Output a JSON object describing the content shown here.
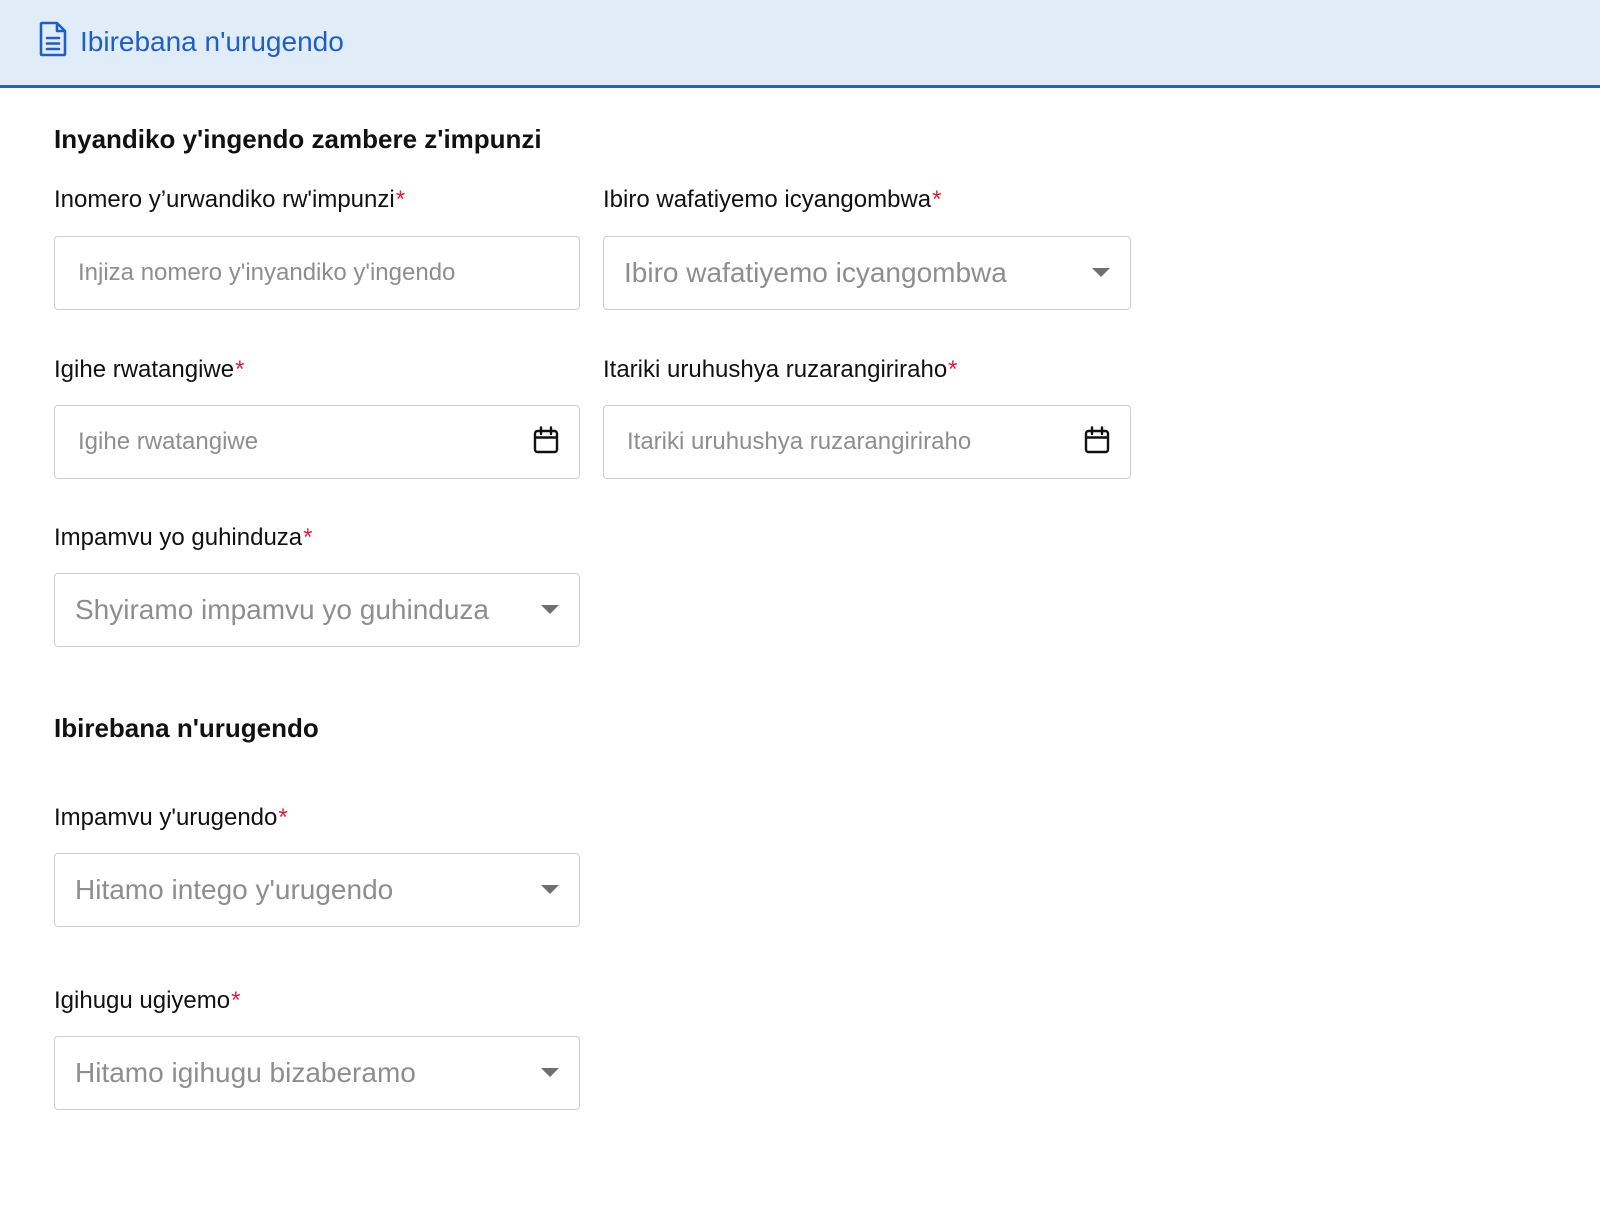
{
  "header": {
    "title": "Ibirebana n'urugendo",
    "icon": "document-icon",
    "accent_color": "#1f5fc4",
    "background_color": "#e1ecf9"
  },
  "sections": [
    {
      "title": "Inyandiko y'ingendo zambere z'impunzi",
      "fields": [
        {
          "label": "Inomero y’urwandiko rw'impunzi",
          "required": true,
          "type": "text",
          "placeholder": "Injiza nomero y'inyandiko y'ingendo"
        },
        {
          "label": "Ibiro wafatiyemo icyangombwa",
          "required": true,
          "type": "select",
          "placeholder": "Ibiro wafatiyemo icyangombwa"
        },
        {
          "label": "Igihe rwatangiwe",
          "required": true,
          "type": "date",
          "placeholder": "Igihe rwatangiwe",
          "icon": "calendar-icon"
        },
        {
          "label": "Itariki uruhushya ruzarangiriraho",
          "required": true,
          "type": "date",
          "placeholder": "Itariki uruhushya ruzarangiriraho",
          "icon": "calendar-icon"
        },
        {
          "label": "Impamvu yo guhinduza",
          "required": true,
          "type": "select",
          "placeholder": "Shyiramo impamvu yo guhinduza"
        }
      ]
    },
    {
      "title": "Ibirebana n'urugendo",
      "fields": [
        {
          "label": "Impamvu y'urugendo",
          "required": true,
          "type": "select",
          "placeholder": "Hitamo intego y'urugendo"
        },
        {
          "label": "Igihugu ugiyemo",
          "required": true,
          "type": "select",
          "placeholder": "Hitamo igihugu bizaberamo"
        }
      ]
    }
  ],
  "required_marker": "*",
  "required_color": "#d6213b"
}
